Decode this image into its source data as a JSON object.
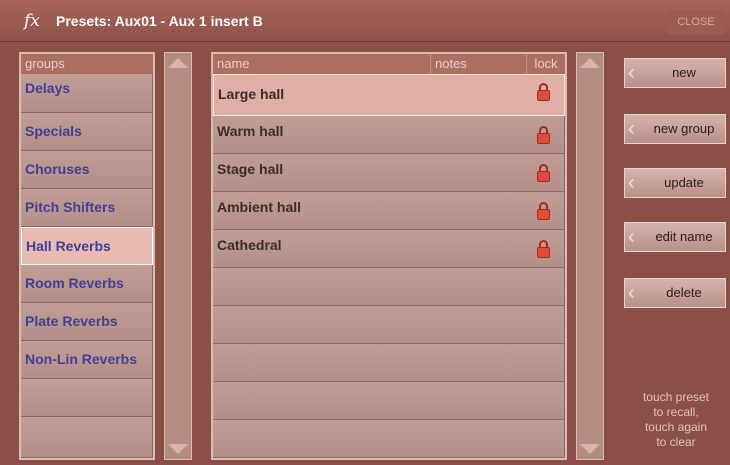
{
  "title": {
    "fx": "fx",
    "text": "Presets: Aux01 - Aux 1 insert B",
    "close": "CLOSE"
  },
  "groups": {
    "header": "groups",
    "items": [
      "Delays",
      "Specials",
      "Choruses",
      "Pitch Shifters",
      "Hall Reverbs",
      "Room Reverbs",
      "Plate Reverbs",
      "Non-Lin Reverbs",
      "",
      ""
    ],
    "selected": "Hall Reverbs"
  },
  "presets": {
    "headers": {
      "name": "name",
      "notes": "notes",
      "lock": "lock"
    },
    "items": [
      {
        "name": "Large hall",
        "locked": true
      },
      {
        "name": "Warm hall",
        "locked": true
      },
      {
        "name": "Stage hall",
        "locked": true
      },
      {
        "name": "Ambient hall",
        "locked": true
      },
      {
        "name": "Cathedral",
        "locked": true
      },
      {
        "name": "",
        "locked": false
      },
      {
        "name": "",
        "locked": false
      },
      {
        "name": "",
        "locked": false
      },
      {
        "name": "",
        "locked": false
      },
      {
        "name": "",
        "locked": false
      }
    ],
    "selected": "Large hall"
  },
  "buttons": {
    "new": "new",
    "new_group": "new group",
    "update": "update",
    "edit_name": "edit name",
    "delete": "delete"
  },
  "hint": {
    "line1": "touch preset",
    "line2": "to recall,",
    "line3": "touch again",
    "line4": "to clear"
  },
  "colors": {
    "group_text": "#3f3f9a",
    "lock_icon": "#e24a3a",
    "background": "#8a4f45"
  }
}
